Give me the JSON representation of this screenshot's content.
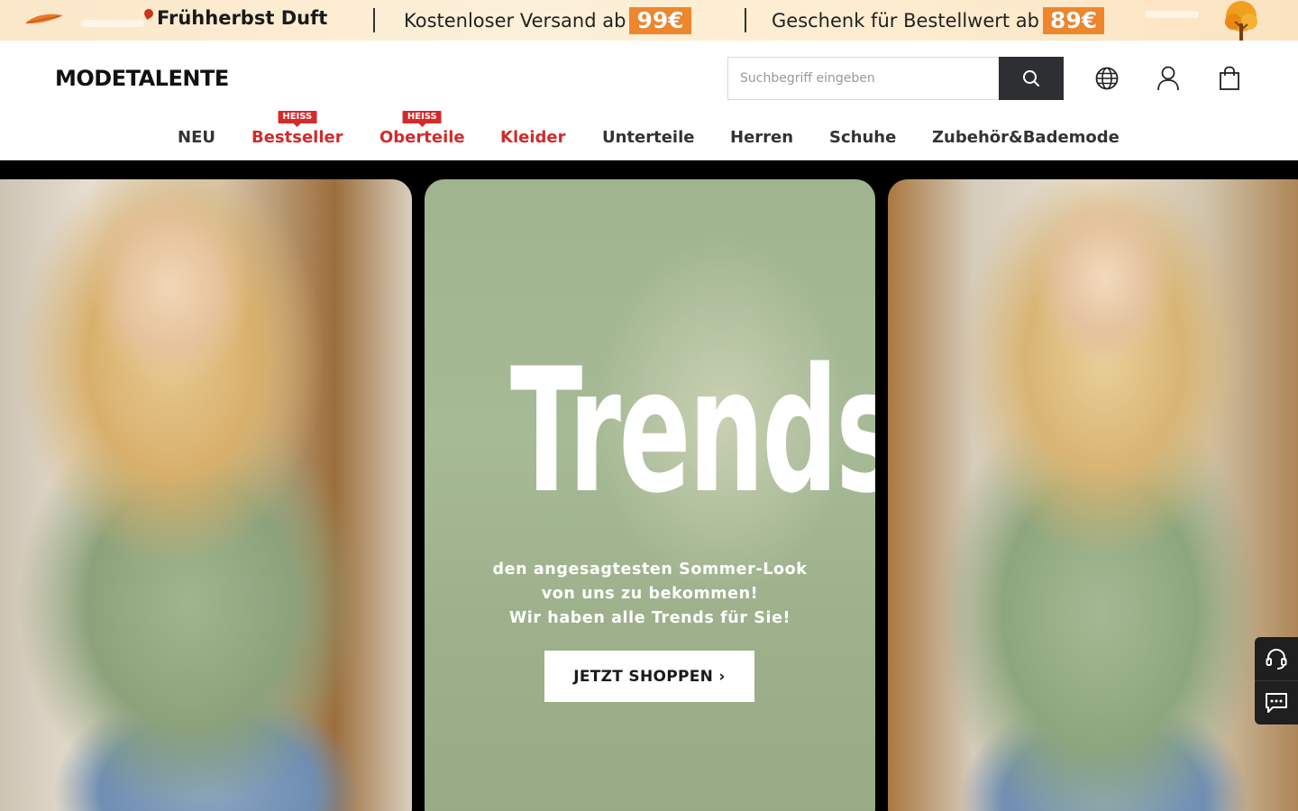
{
  "promo": {
    "headline": "Frühherbst Duft",
    "shipping_text": "Kostenloser Versand ab",
    "shipping_price": "99€",
    "gift_text": "Geschenk für Bestellwert ab",
    "gift_price": "89€"
  },
  "header": {
    "logo": "MODETALENTE",
    "search_placeholder": "Suchbegriff eingeben",
    "icons": [
      "search-icon",
      "globe-icon",
      "user-icon",
      "shopping-bag-icon"
    ]
  },
  "nav": {
    "items": [
      {
        "label": "NEU",
        "badge": ""
      },
      {
        "label": "Bestseller",
        "badge": "HEISS"
      },
      {
        "label": "Oberteile",
        "badge": "HEISS"
      },
      {
        "label": "Kleider",
        "badge": ""
      },
      {
        "label": "Unterteile",
        "badge": ""
      },
      {
        "label": "Herren",
        "badge": ""
      },
      {
        "label": "Schuhe",
        "badge": ""
      },
      {
        "label": "Zubehör&Bademode",
        "badge": ""
      }
    ]
  },
  "hero": {
    "title": "Trends",
    "tagline_line1": "den angesagtesten Sommer-Look",
    "tagline_line2": "von uns zu bekommen!",
    "tagline_line3": "Wir haben alle Trends für Sie!",
    "cta": "JETZT SHOPPEN ›"
  },
  "side_tools": [
    "headset-icon",
    "chat-icon"
  ],
  "colors": {
    "accent_red": "#d42a2a",
    "promo_price": "#f0862b",
    "dark": "#2e2f33"
  }
}
